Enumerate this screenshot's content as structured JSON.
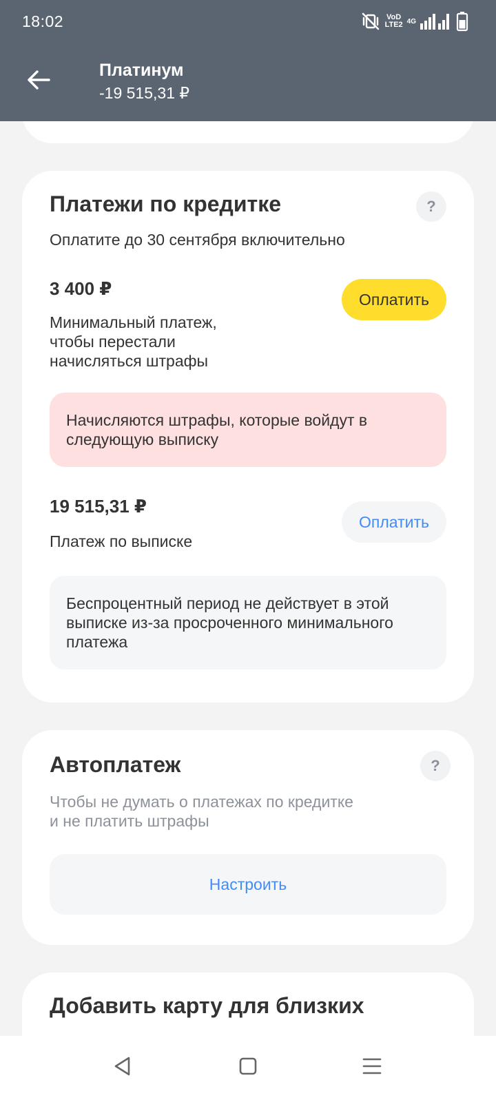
{
  "status_bar": {
    "time": "18:02",
    "lte_top": "VoD",
    "lte_bottom": "LTE2",
    "network": "4G"
  },
  "header": {
    "title": "Платинум",
    "balance": "-19 515,31 ₽"
  },
  "payments": {
    "title": "Платежи по кредитке",
    "help": "?",
    "due_text": "Оплатите до 30 сентября включительно",
    "minimum": {
      "amount": "3 400 ₽",
      "description_lines": [
        "Минимальный платеж,",
        "чтобы перестали",
        "начисляться штрафы"
      ],
      "pay_label": "Оплатить"
    },
    "penalty_notice_lines": [
      "Начисляются штрафы, которые войдут в",
      "следующую выписку"
    ],
    "statement": {
      "amount": "19 515,31 ₽",
      "description": "Платеж по выписке",
      "pay_label": "Оплатить"
    },
    "grace_notice_lines": [
      "Беспроцентный период не действует в этой",
      "выписке из-за просроченного минимального",
      "платежа"
    ]
  },
  "autopay": {
    "title": "Автоплатеж",
    "help": "?",
    "subtitle_lines": [
      "Чтобы не думать о платежах по кредитке",
      "и не платить штрафы"
    ],
    "setup_label": "Настроить"
  },
  "add_card": {
    "title": "Добавить карту для близких"
  },
  "colors": {
    "header_bg": "#5b6572",
    "accent_yellow": "#ffdd2d",
    "link_blue": "#428bf9",
    "alert_bg": "#ffe0e0",
    "panel_bg": "#f5f6f7",
    "page_bg": "#f3f3f3"
  },
  "icons": {
    "back": "arrow-left-icon",
    "mute": "vibrate-off-icon",
    "signal": "signal-bars-icon",
    "battery": "battery-icon",
    "nav_back": "triangle-back-icon",
    "nav_home": "square-home-icon",
    "nav_menu": "hamburger-menu-icon"
  }
}
